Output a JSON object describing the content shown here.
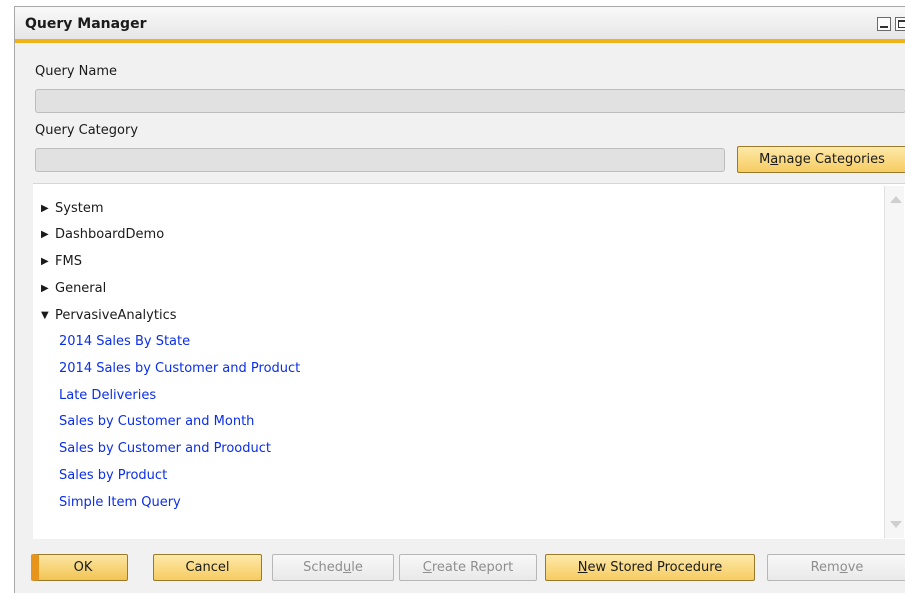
{
  "window": {
    "title": "Query Manager"
  },
  "form": {
    "query_name_label": "Query Name",
    "query_name_value": "",
    "query_category_label": "Query Category",
    "query_category_value": "",
    "manage_categories": {
      "pre": "M",
      "key": "a",
      "post": "nage Categories"
    }
  },
  "tree": {
    "categories": [
      {
        "label": "System",
        "expanded": false
      },
      {
        "label": "DashboardDemo",
        "expanded": false
      },
      {
        "label": "FMS",
        "expanded": false
      },
      {
        "label": "General",
        "expanded": false
      },
      {
        "label": "PervasiveAnalytics",
        "expanded": true
      }
    ],
    "queries": [
      "2014 Sales By State",
      "2014 Sales by Customer and Product",
      "Late Deliveries",
      "Sales by Customer and Month",
      "Sales by Customer and Prooduct",
      "Sales by Product",
      "Simple Item Query"
    ],
    "collapsed_glyph": "▶",
    "expanded_glyph": "▼"
  },
  "buttons": {
    "ok": "OK",
    "cancel": "Cancel",
    "schedule": {
      "pre": "Sched",
      "key": "u",
      "post": "le"
    },
    "create_report": {
      "pre": "",
      "key": "C",
      "post": "reate Report"
    },
    "new_stored_procedure": {
      "pre": "",
      "key": "N",
      "post": "ew Stored Procedure"
    },
    "remove": {
      "pre": "Rem",
      "key": "o",
      "post": "ve"
    }
  },
  "colors": {
    "accent": "#f2b31a",
    "button": "#f6cc62",
    "link": "#0b2ee8"
  }
}
